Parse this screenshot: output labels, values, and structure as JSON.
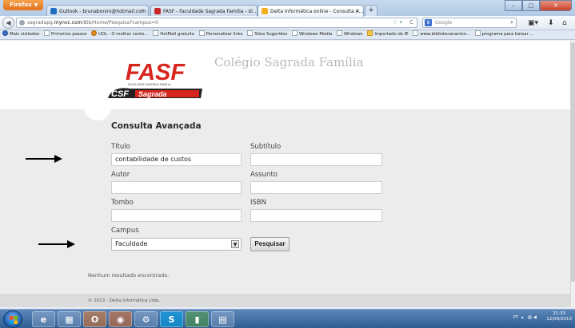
{
  "browser": {
    "app_button": "Firefox",
    "tabs": [
      {
        "label": "Outlook - brunabonini@hotmail.com",
        "favicon_color": "#1f6fc1"
      },
      {
        "label": "FASF - Faculdade Sagrada Família - U...",
        "favicon_color": "#c62828"
      },
      {
        "label": "Delta Informática online - Consulta A...",
        "favicon_color": "#f2b01e"
      }
    ],
    "new_tab": "+",
    "url_prefix": "sagradapg.",
    "url_host": "mynvc.com",
    "url_path": "/Bib/Home/Pesquisa?campus=0",
    "search_placeholder": "Google",
    "bookmarks": [
      "Mais visitados",
      "Primeiros passos",
      "UOL - O melhor conte...",
      "HotMail gratuito",
      "Personalizar links",
      "Sites Sugeridos",
      "Windows Media",
      "Windows",
      "Importado do IE",
      "www.bibliotecanacion...",
      "programa para baixar ..."
    ]
  },
  "page": {
    "logo_text": "FASF",
    "logo_tagline": "FACULDADE SAGRADA FAMÍLIA",
    "logo_brand": "CSF",
    "logo_brand2": "Sagrada",
    "site_title": "Colégio Sagrada Família",
    "form_heading": "Consulta Avançada",
    "labels": {
      "titulo": "Título",
      "subtitulo": "Subtítulo",
      "autor": "Autor",
      "assunto": "Assunto",
      "tombo": "Tombo",
      "isbn": "ISBN",
      "campus": "Campus"
    },
    "values": {
      "titulo": "contabilidade de custos",
      "subtitulo": "",
      "autor": "",
      "assunto": "",
      "tombo": "",
      "isbn": ""
    },
    "campus_selected": "Faculdade",
    "search_button": "Pesquisar",
    "empty_message": "Nenhum resultado encontrado.",
    "footer": "© 2013 - Delta Informática Ltda."
  },
  "taskbar": {
    "items": [
      "e",
      "▦",
      "O",
      "◉",
      "⚙",
      "S",
      "▮",
      "▤"
    ],
    "language": "PT",
    "time": "21:33",
    "date": "12/09/2013"
  },
  "colors": {
    "logo_red": "#d7261e",
    "logo_dark": "#222222",
    "title_gray": "#b9b9b9",
    "page_bg": "#ececec"
  }
}
